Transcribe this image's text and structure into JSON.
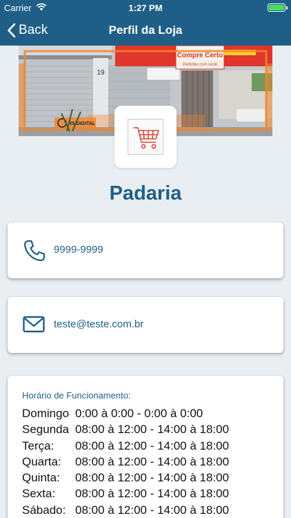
{
  "status_bar": {
    "carrier": "Carrier",
    "time": "1:27 PM",
    "battery_level": 1.0
  },
  "nav": {
    "back_label": "Back",
    "title": "Perfil da Loja"
  },
  "banner": {
    "sign_main": "Compre Certo",
    "sign_tagline": "Pertinho com você",
    "sign_number": "19",
    "sign_left": "RS DIGITAL"
  },
  "store": {
    "name": "Padaria"
  },
  "contact": {
    "phone": "9999-9999",
    "email": "teste@teste.com.br"
  },
  "hours": {
    "title": "Horário de Funcionamento:",
    "rows": [
      {
        "day": "Domingo",
        "time": "0:00 à 0:00 - 0:00 à 0:00"
      },
      {
        "day": "Segunda",
        "time": "08:00 à 12:00 - 14:00 à 18:00"
      },
      {
        "day": "Terça:",
        "time": "08:00 à 12:00 - 14:00 à 18:00"
      },
      {
        "day": "Quarta:",
        "time": "08:00 à 12:00 - 14:00 à 18:00"
      },
      {
        "day": "Quinta:",
        "time": "08:00 à 12:00 - 14:00 à 18:00"
      },
      {
        "day": "Sexta:",
        "time": "08:00 à 12:00 - 14:00 à 18:00"
      },
      {
        "day": "Sábado:",
        "time": "08:00 à 12:00 - 14:00 à 18:00"
      }
    ]
  },
  "colors": {
    "primary": "#1f5f87",
    "accent_orange": "#f0852b",
    "cart_red": "#d9473c",
    "battery": "#46e05a"
  }
}
